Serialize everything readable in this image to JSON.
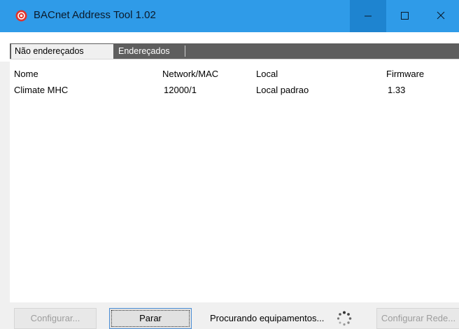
{
  "window": {
    "title": "BACnet Address Tool 1.02"
  },
  "tabs": [
    {
      "label": "Não endereçados",
      "active": true
    },
    {
      "label": "Endereçados",
      "active": false
    }
  ],
  "table": {
    "columns": [
      "Nome",
      "Network/MAC",
      "Local",
      "Firmware"
    ],
    "rows": [
      [
        "Climate MHC",
        "12000/1",
        "Local padrao",
        "1.33"
      ]
    ]
  },
  "buttons": {
    "configure": "Configurar...",
    "stop": "Parar",
    "configure_network": "Configurar Rede..."
  },
  "status": "Procurando equipamentos...",
  "colors": {
    "titlebar": "#2f9be8",
    "tabbar": "#5e5e5e",
    "app_icon": "#e0342c"
  }
}
